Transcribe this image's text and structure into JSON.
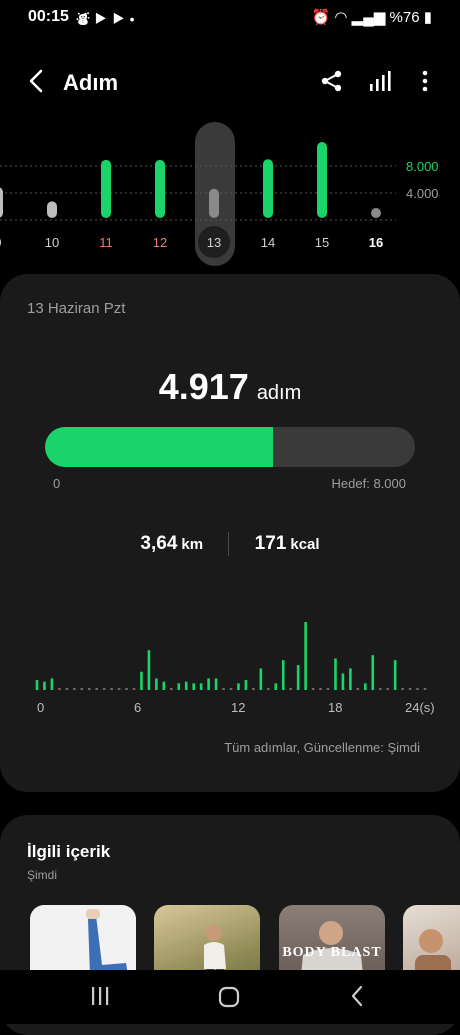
{
  "status_bar": {
    "time": "00:15",
    "battery": "%76",
    "left_icons": "⛇ ▶ ▶ •"
  },
  "header": {
    "title": "Adım",
    "back_icon": "back-chevron-icon",
    "share_icon": "share-icon",
    "stats_icon": "bar-chart-icon",
    "more_icon": "more-vert-icon"
  },
  "week_chart": {
    "gridline_labels": [
      "8.000",
      "4.000"
    ],
    "days": [
      {
        "label": "9",
        "value": 5200
      },
      {
        "label": "10",
        "value": 2800
      },
      {
        "label": "11",
        "value": 9800
      },
      {
        "label": "12",
        "value": 9800
      },
      {
        "label": "13",
        "value": 4917,
        "selected": true
      },
      {
        "label": "14",
        "value": 9900
      },
      {
        "label": "15",
        "value": 12800
      },
      {
        "label": "16",
        "value": 0,
        "today": true
      }
    ]
  },
  "day_card": {
    "date": "13 Haziran Pzt",
    "steps": "4.917",
    "steps_unit": "adım",
    "progress_fraction": 0.615,
    "progress_min": "0",
    "goal_label": "Hedef: 8.000",
    "distance": "3,64",
    "distance_unit": "km",
    "calories": "171",
    "calories_unit": "kcal",
    "footnote": "Tüm adımlar, Güncellenme: Şimdi"
  },
  "chart_data": {
    "type": "bar",
    "x_tick_labels": [
      "0",
      "6",
      "12",
      "18",
      "24(s)"
    ],
    "values": [
      12,
      10,
      14,
      4,
      4,
      4,
      4,
      4,
      4,
      4,
      4,
      4,
      4,
      4,
      22,
      48,
      14,
      10,
      4,
      8,
      10,
      8,
      8,
      14,
      14,
      4,
      4,
      8,
      12,
      4,
      26,
      4,
      8,
      36,
      4,
      30,
      82,
      4,
      4,
      4,
      38,
      20,
      26,
      4,
      8,
      42,
      4,
      4,
      36,
      4,
      4,
      4,
      4
    ],
    "series_color": "#1ad36a"
  },
  "related": {
    "title": "İlgili içerik",
    "subtitle": "Şimdi",
    "items": [
      {
        "name": "yoga-legs"
      },
      {
        "name": "runner"
      },
      {
        "name": "body-blast",
        "caption": "BODY BLAST"
      },
      {
        "name": "trainer"
      }
    ]
  },
  "colors": {
    "accent": "#1ad36a",
    "card": "#1a1a1a",
    "weekend": "#e87a7a"
  }
}
